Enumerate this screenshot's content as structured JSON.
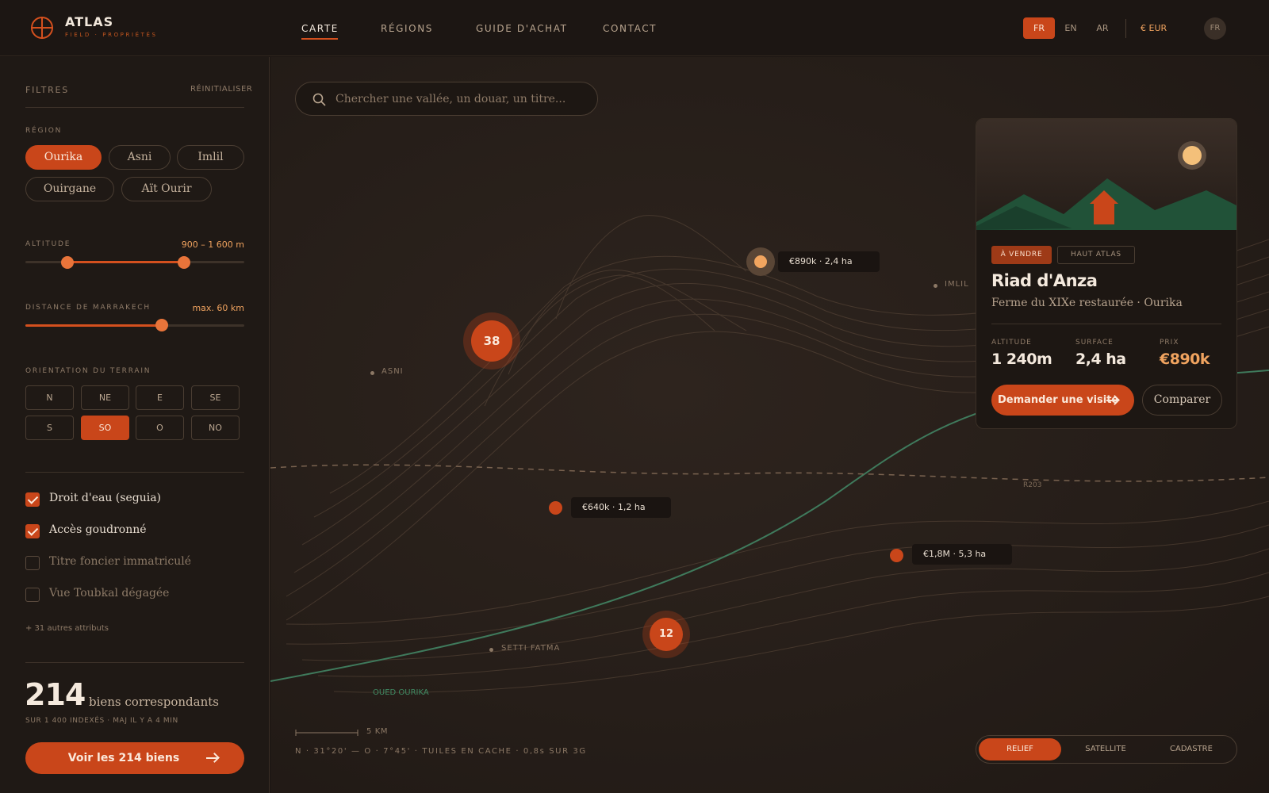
{
  "brand": {
    "name": "ATLAS",
    "tagline": "FIELD · PROPRIÉTÉS"
  },
  "nav": [
    {
      "label": "CARTE",
      "active": true
    },
    {
      "label": "RÉGIONS",
      "active": false
    },
    {
      "label": "GUIDE D'ACHAT",
      "active": false
    },
    {
      "label": "CONTACT",
      "active": false
    }
  ],
  "languages": [
    {
      "label": "FR",
      "active": true
    },
    {
      "label": "EN",
      "active": false
    },
    {
      "label": "AR",
      "active": false
    }
  ],
  "currency": "€ EUR",
  "user_initials": "FR",
  "filters": {
    "title": "FILTRES",
    "reset_label": "RÉINITIALISER",
    "region": {
      "label": "RÉGION",
      "options": [
        {
          "label": "Ourika",
          "active": true
        },
        {
          "label": "Asni",
          "active": false
        },
        {
          "label": "Imlil",
          "active": false
        },
        {
          "label": "Ouirgane",
          "active": false
        },
        {
          "label": "Aït Ourir",
          "active": false
        }
      ]
    },
    "altitude": {
      "label": "ALTITUDE",
      "value": "900 – 1 600 m",
      "low_fraction": 0.2,
      "high_fraction": 0.72
    },
    "distance": {
      "label": "DISTANCE DE MARRAKECH",
      "value": "max. 60 km",
      "fraction": 0.62
    },
    "orientation": {
      "label": "ORIENTATION DU TERRAIN",
      "options": [
        {
          "label": "N",
          "active": false
        },
        {
          "label": "NE",
          "active": false
        },
        {
          "label": "E",
          "active": false
        },
        {
          "label": "SE",
          "active": false
        },
        {
          "label": "S",
          "active": false
        },
        {
          "label": "SO",
          "active": true
        },
        {
          "label": "O",
          "active": false
        },
        {
          "label": "NO",
          "active": false
        }
      ]
    },
    "attributes": [
      {
        "label": "Droit d'eau (seguia)",
        "checked": true
      },
      {
        "label": "Accès goudronné",
        "checked": true
      },
      {
        "label": "Titre foncier immatriculé",
        "checked": false
      },
      {
        "label": "Vue Toubkal dégagée",
        "checked": false
      }
    ],
    "more_attributes": "+ 31 autres attributs"
  },
  "results": {
    "count": "214",
    "count_label": "biens correspondants",
    "meta": "SUR 1 400 INDEXÉS · MAJ IL Y A 4 MIN",
    "cta_label": "Voir les 214 biens"
  },
  "search": {
    "placeholder": "Chercher une vallée, un douar, un titre..."
  },
  "map": {
    "places": [
      "ASNI",
      "IMLIL",
      "SETTI FATMA"
    ],
    "river_label": "OUED OURIKA",
    "road_label": "R203",
    "clusters": [
      "38",
      "12"
    ],
    "listings": [
      {
        "label": "€890k · 2,4 ha",
        "selected": true
      },
      {
        "label": "€640k · 1,2 ha",
        "selected": false
      },
      {
        "label": "€1,8M · 5,3 ha",
        "selected": false
      }
    ],
    "scale_label": "5 KM",
    "coordinates": "N · 31°20' — O · 7°45' · TUILES EN CACHE · 0,8s SUR 3G",
    "layers": [
      {
        "label": "RELIEF",
        "active": true
      },
      {
        "label": "SATELLITE",
        "active": false
      },
      {
        "label": "CADASTRE",
        "active": false
      }
    ]
  },
  "property": {
    "status_tag": "À VENDRE",
    "region_tag": "HAUT ATLAS",
    "title": "Riad d'Anza",
    "subtitle": "Ferme du XIXe restaurée · Ourika",
    "stats": [
      {
        "label": "ALTITUDE",
        "value": "1 240m"
      },
      {
        "label": "SURFACE",
        "value": "2,4 ha"
      },
      {
        "label": "PRIX",
        "value": "€890k"
      }
    ],
    "visit_label": "Demander une visite",
    "compare_label": "Comparer"
  },
  "colors": {
    "accent": "#c9461a",
    "highlight": "#f0a35f",
    "river": "#3f7a5c",
    "background": "#1a1411"
  }
}
